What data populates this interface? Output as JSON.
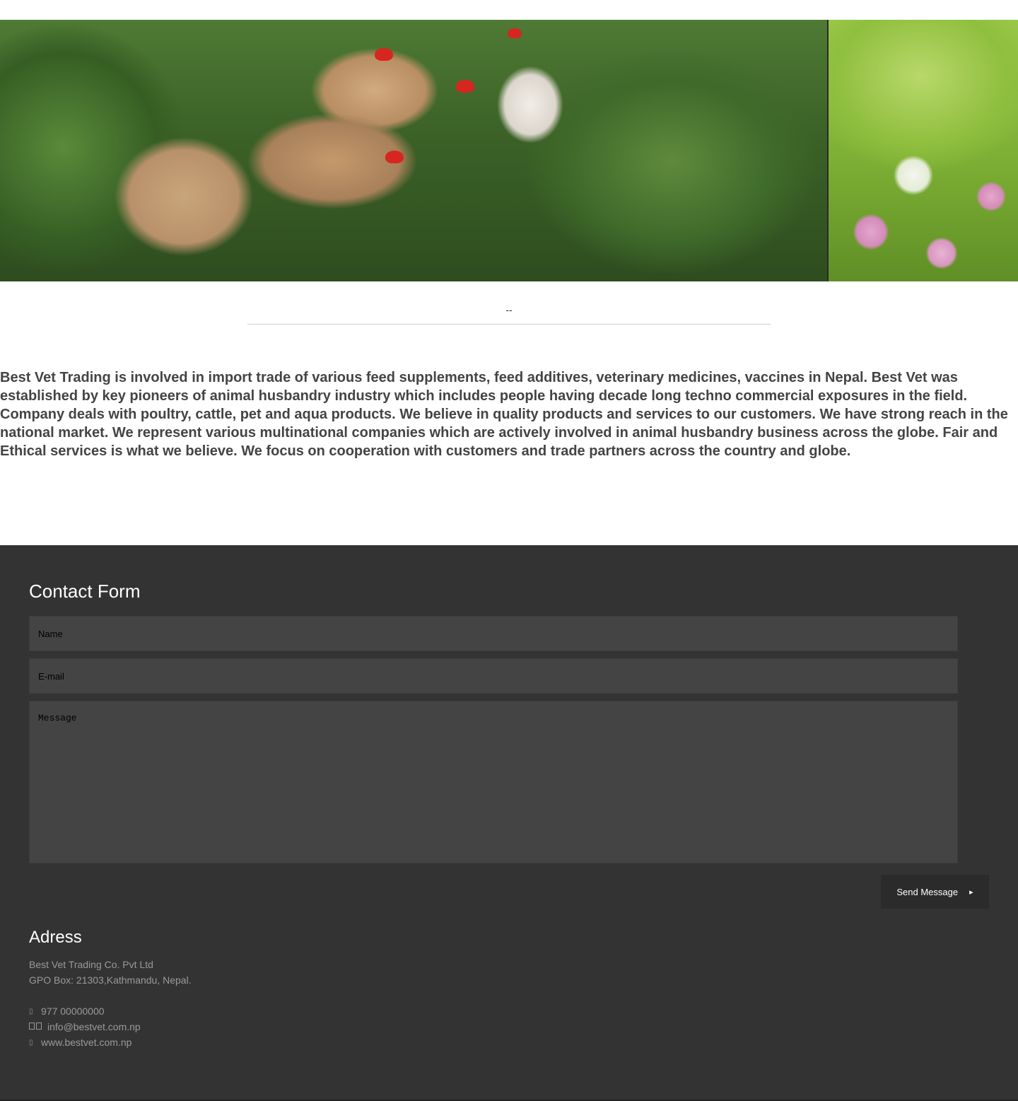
{
  "about": {
    "divider_text": "--",
    "paragraph": "Best Vet Trading is involved in import trade of various feed supplements, feed additives, veterinary medicines, vaccines in Nepal. Best Vet was established by key pioneers of animal husbandry industry which includes people having decade long techno commercial exposures in the field. Company deals with poultry, cattle, pet and aqua products. We believe in quality products and services to our customers. We have strong reach in the national market. We represent various multinational companies which are actively involved in animal husbandry business across the globe. Fair and Ethical services is what we believe. We focus on cooperation with customers and trade partners across the country and globe."
  },
  "contact_form": {
    "title": "Contact Form",
    "name_placeholder": "Name",
    "email_placeholder": "E-mail",
    "message_placeholder": "Message",
    "send_label": "Send Message",
    "send_icon": "arrow-right-icon"
  },
  "address": {
    "title": "Adress",
    "company": "Best Vet Trading Co. Pvt Ltd",
    "po_box": "GPO Box: 21303,Kathmandu, Nepal.",
    "phone": "977 00000000",
    "email": "info@bestvet.com.np",
    "website": "www.bestvet.com.np",
    "phone_icon": "phone-icon",
    "email_icon": "envelope-icon",
    "website_icon": "globe-icon"
  },
  "colors": {
    "footer_bg": "#333333",
    "field_bg": "#444444",
    "button_bg": "#2b2b2b",
    "about_text": "#444444"
  }
}
